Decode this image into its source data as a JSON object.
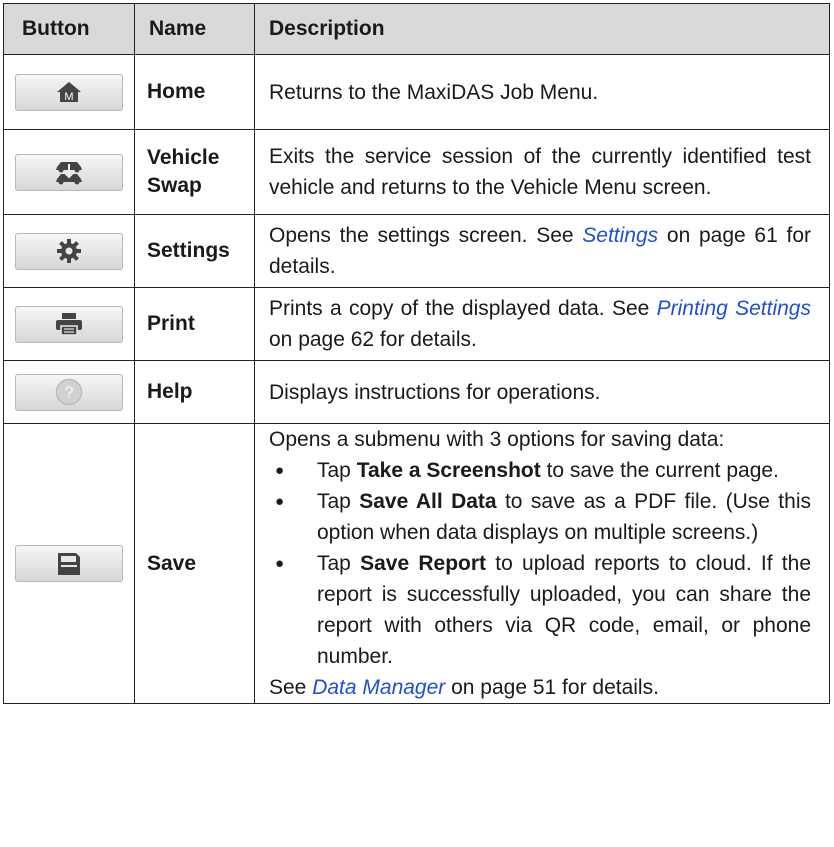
{
  "headers": {
    "button": "Button",
    "name": "Name",
    "description": "Description"
  },
  "rows": [
    {
      "icon": "home-icon",
      "icon_letter": "M",
      "name": "Home",
      "desc": "Returns to the MaxiDAS Job Menu."
    },
    {
      "icon": "vehicle-swap-icon",
      "name_line1": "Vehicle",
      "name_line2": "Swap",
      "desc": "Exits the service session of the currently identified test vehicle and returns to the Vehicle Menu screen."
    },
    {
      "icon": "gear-icon",
      "name": "Settings",
      "desc_pre": "Opens the settings screen. See ",
      "link": "Settings",
      "desc_post": " on page 61 for details."
    },
    {
      "icon": "printer-icon",
      "name": "Print",
      "desc_pre": "Prints a copy of the displayed data. See ",
      "link": "Printing Settings",
      "desc_post": " on page 62 for details."
    },
    {
      "icon": "help-icon",
      "name": "Help",
      "desc": "Displays instructions for operations."
    },
    {
      "icon": "save-icon",
      "name": "Save",
      "intro": "Opens a submenu with 3 options for saving data:",
      "bullets": [
        {
          "pre": "Tap ",
          "bold": "Take a Screenshot",
          "post": " to save the current page."
        },
        {
          "pre": "Tap ",
          "bold": "Save All Data",
          "post": " to save as a PDF file. (Use this option when data displays on multiple screens.)"
        },
        {
          "pre": "Tap ",
          "bold": "Save Report",
          "post": " to upload reports to cloud. If the report is successfully uploaded, you can share the report with others via QR code, email, or phone number."
        }
      ],
      "outro_pre": "See ",
      "outro_link": "Data Manager",
      "outro_post": " on page 51 for details."
    }
  ],
  "colors": {
    "header_bg": "#d9d9d9",
    "link": "#1f4fd8",
    "icon": "#444444"
  }
}
